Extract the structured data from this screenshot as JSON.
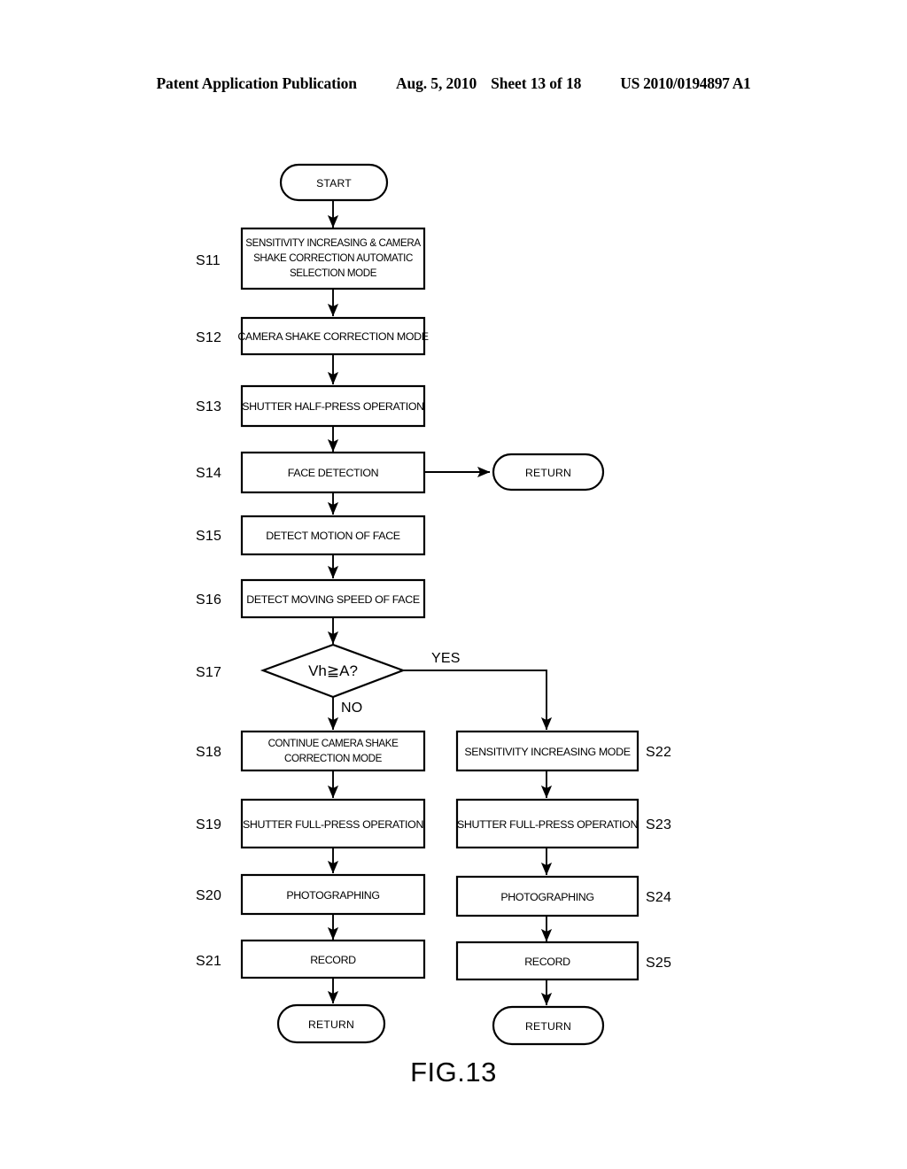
{
  "header": {
    "title": "Patent Application Publication",
    "date": "Aug. 5, 2010",
    "sheet": "Sheet 13 of 18",
    "number": "US 2010/0194897 A1"
  },
  "figure": {
    "caption": "FIG.13"
  },
  "chart_data": {
    "type": "diagram",
    "diagram_type": "flowchart",
    "title": "FIG.13",
    "nodes": [
      {
        "id": "start",
        "step": "",
        "shape": "terminator",
        "text": "START"
      },
      {
        "id": "s11",
        "step": "S11",
        "shape": "process",
        "text": "SENSITIVITY INCREASING & CAMERA SHAKE CORRECTION AUTOMATIC SELECTION MODE"
      },
      {
        "id": "s12",
        "step": "S12",
        "shape": "process",
        "text": "CAMERA SHAKE CORRECTION MODE"
      },
      {
        "id": "s13",
        "step": "S13",
        "shape": "process",
        "text": "SHUTTER HALF-PRESS OPERATION"
      },
      {
        "id": "s14",
        "step": "S14",
        "shape": "process",
        "text": "FACE DETECTION"
      },
      {
        "id": "ret_a",
        "step": "",
        "shape": "terminator",
        "text": "RETURN"
      },
      {
        "id": "s15",
        "step": "S15",
        "shape": "process",
        "text": "DETECT MOTION OF FACE"
      },
      {
        "id": "s16",
        "step": "S16",
        "shape": "process",
        "text": "DETECT MOVING SPEED OF FACE"
      },
      {
        "id": "s17",
        "step": "S17",
        "shape": "decision",
        "text": "Vh≧A?"
      },
      {
        "id": "s18",
        "step": "S18",
        "shape": "process",
        "text": "CONTINUE CAMERA SHAKE CORRECTION MODE"
      },
      {
        "id": "s19",
        "step": "S19",
        "shape": "process",
        "text": "SHUTTER FULL-PRESS OPERATION"
      },
      {
        "id": "s20",
        "step": "S20",
        "shape": "process",
        "text": "PHOTOGRAPHING"
      },
      {
        "id": "s21",
        "step": "S21",
        "shape": "process",
        "text": "RECORD"
      },
      {
        "id": "ret_b",
        "step": "",
        "shape": "terminator",
        "text": "RETURN"
      },
      {
        "id": "s22",
        "step": "S22",
        "shape": "process",
        "text": "SENSITIVITY INCREASING MODE"
      },
      {
        "id": "s23",
        "step": "S23",
        "shape": "process",
        "text": "SHUTTER FULL-PRESS OPERATION"
      },
      {
        "id": "s24",
        "step": "S24",
        "shape": "process",
        "text": "PHOTOGRAPHING"
      },
      {
        "id": "s25",
        "step": "S25",
        "shape": "process",
        "text": "RECORD"
      },
      {
        "id": "ret_c",
        "step": "",
        "shape": "terminator",
        "text": "RETURN"
      }
    ],
    "edges": [
      {
        "from": "start",
        "to": "s11",
        "label": ""
      },
      {
        "from": "s11",
        "to": "s12",
        "label": ""
      },
      {
        "from": "s12",
        "to": "s13",
        "label": ""
      },
      {
        "from": "s13",
        "to": "s14",
        "label": ""
      },
      {
        "from": "s14",
        "to": "ret_a",
        "label": ""
      },
      {
        "from": "s14",
        "to": "s15",
        "label": ""
      },
      {
        "from": "s15",
        "to": "s16",
        "label": ""
      },
      {
        "from": "s16",
        "to": "s17",
        "label": ""
      },
      {
        "from": "s17",
        "to": "s18",
        "label": "NO"
      },
      {
        "from": "s17",
        "to": "s22",
        "label": "YES"
      },
      {
        "from": "s18",
        "to": "s19",
        "label": ""
      },
      {
        "from": "s19",
        "to": "s20",
        "label": ""
      },
      {
        "from": "s20",
        "to": "s21",
        "label": ""
      },
      {
        "from": "s21",
        "to": "ret_b",
        "label": ""
      },
      {
        "from": "s22",
        "to": "s23",
        "label": ""
      },
      {
        "from": "s23",
        "to": "s24",
        "label": ""
      },
      {
        "from": "s24",
        "to": "s25",
        "label": ""
      },
      {
        "from": "s25",
        "to": "ret_c",
        "label": ""
      }
    ],
    "branch_labels": {
      "yes": "YES",
      "no": "NO"
    }
  },
  "nodes": {
    "start": {
      "text": "START"
    },
    "s11": {
      "step": "S11",
      "line1": "SENSITIVITY INCREASING & CAMERA",
      "line2": "SHAKE CORRECTION AUTOMATIC",
      "line3": "SELECTION MODE"
    },
    "s12": {
      "step": "S12",
      "text": "CAMERA SHAKE CORRECTION MODE"
    },
    "s13": {
      "step": "S13",
      "text": "SHUTTER HALF-PRESS OPERATION"
    },
    "s14": {
      "step": "S14",
      "text": "FACE DETECTION"
    },
    "ret_a": {
      "text": "RETURN"
    },
    "s15": {
      "step": "S15",
      "text": "DETECT MOTION OF FACE"
    },
    "s16": {
      "step": "S16",
      "text": "DETECT MOVING SPEED OF FACE"
    },
    "s17": {
      "step": "S17",
      "text": "Vh≧A?"
    },
    "s18": {
      "step": "S18",
      "line1": "CONTINUE CAMERA SHAKE",
      "line2": "CORRECTION MODE"
    },
    "s19": {
      "step": "S19",
      "text": "SHUTTER FULL-PRESS OPERATION"
    },
    "s20": {
      "step": "S20",
      "text": "PHOTOGRAPHING"
    },
    "s21": {
      "step": "S21",
      "text": "RECORD"
    },
    "ret_b": {
      "text": "RETURN"
    },
    "s22": {
      "step": "S22",
      "text": "SENSITIVITY INCREASING MODE"
    },
    "s23": {
      "step": "S23",
      "text": "SHUTTER FULL-PRESS OPERATION"
    },
    "s24": {
      "step": "S24",
      "text": "PHOTOGRAPHING"
    },
    "s25": {
      "step": "S25",
      "text": "RECORD"
    },
    "ret_c": {
      "text": "RETURN"
    }
  },
  "branches": {
    "yes": "YES",
    "no": "NO"
  },
  "colors": {
    "ink": "#000000",
    "paper": "#ffffff"
  }
}
